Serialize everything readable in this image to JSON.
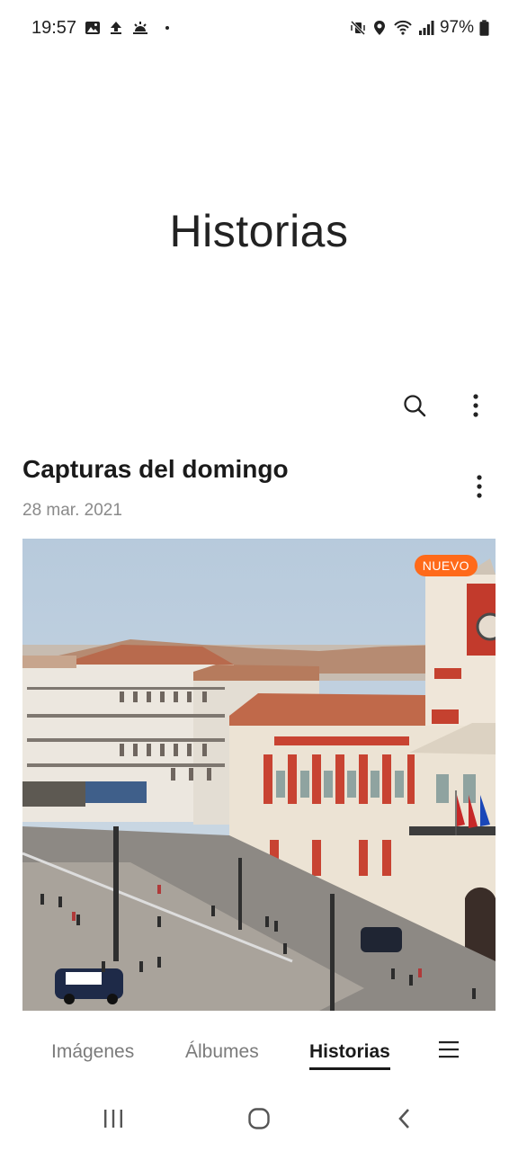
{
  "status_bar": {
    "time": "19:57",
    "battery": "97%",
    "left_icons": [
      "gallery-icon",
      "upload-icon",
      "sunrise-icon",
      "dot-icon"
    ],
    "right_icons": [
      "mute-vibrate-icon",
      "location-icon",
      "wifi-icon",
      "signal-icon",
      "battery-icon"
    ]
  },
  "header": {
    "title": "Historias",
    "actions": [
      "search-icon",
      "more-options-icon"
    ]
  },
  "story": {
    "title": "Capturas del domingo",
    "date": "28 mar. 2021",
    "badge": "NUEVO"
  },
  "tabs": {
    "items": [
      {
        "label": "Imágenes",
        "active": false
      },
      {
        "label": "Álbumes",
        "active": false
      },
      {
        "label": "Historias",
        "active": true
      }
    ],
    "menu_icon": "hamburger-menu-icon"
  },
  "navbar": {
    "buttons": [
      "recent-apps-icon",
      "home-icon",
      "back-icon"
    ]
  },
  "colors": {
    "accent_badge": "#ff6a1a",
    "text_primary": "#1a1a1a",
    "text_secondary": "#8a8a8a"
  }
}
